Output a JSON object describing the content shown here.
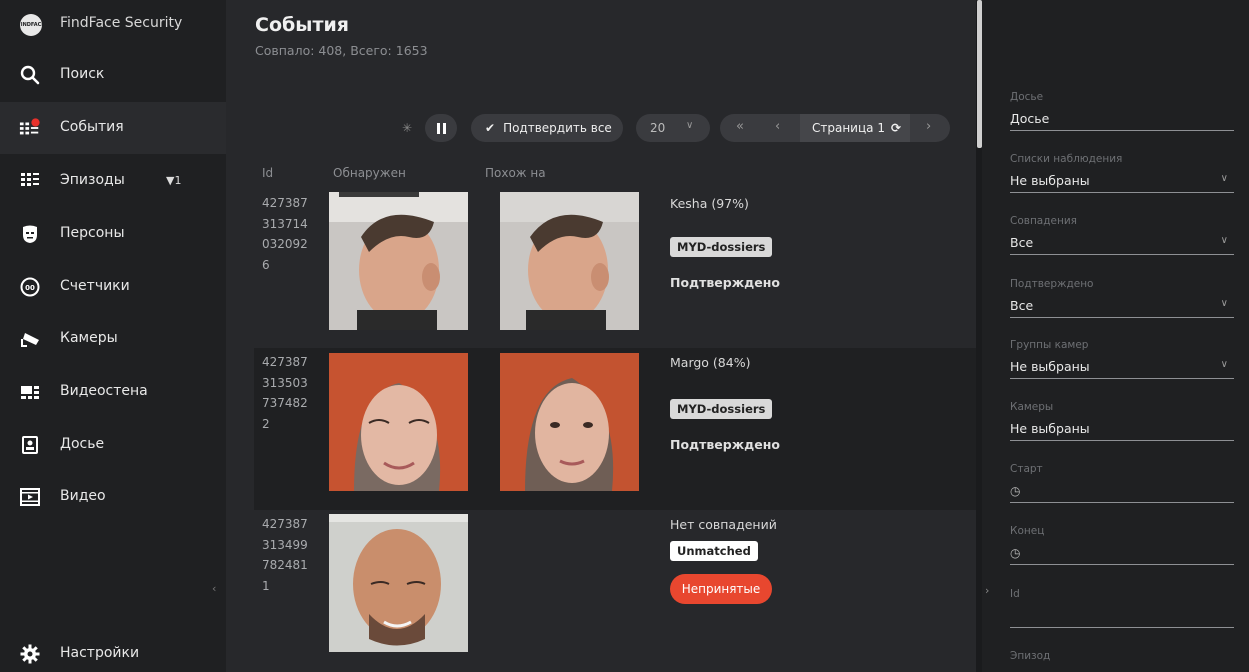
{
  "brand": {
    "name": "FindFace Security",
    "logo_text": "FINDFACE"
  },
  "sidebar": {
    "items": [
      {
        "key": "search",
        "label": "Поиск",
        "icon": "search-icon"
      },
      {
        "key": "events",
        "label": "События",
        "icon": "events-icon",
        "active": true
      },
      {
        "key": "episodes",
        "label": "Эпизоды",
        "icon": "episodes-icon",
        "filter_count": "1"
      },
      {
        "key": "persons",
        "label": "Персоны",
        "icon": "persons-icon"
      },
      {
        "key": "counters",
        "label": "Счетчики",
        "icon": "counters-icon"
      },
      {
        "key": "cameras",
        "label": "Камеры",
        "icon": "camera-icon"
      },
      {
        "key": "videowall",
        "label": "Видеостена",
        "icon": "videowall-icon"
      },
      {
        "key": "dossier",
        "label": "Досье",
        "icon": "dossier-icon"
      },
      {
        "key": "video",
        "label": "Видео",
        "icon": "video-icon"
      }
    ],
    "settings": {
      "label": "Настройки",
      "icon": "gear-icon"
    },
    "collapse_glyph": "‹"
  },
  "main": {
    "title": "События",
    "subtitle": "Совпало: 408, Всего: 1653",
    "toolbar": {
      "confirm_all": "Подтвердить все",
      "page_size": "20",
      "page_label": "Страница 1",
      "first_glyph": "«",
      "prev_glyph": "‹",
      "next_glyph": "›"
    },
    "columns": {
      "id": "Id",
      "detected": "Обнаружен",
      "matched": "Похож на"
    },
    "events": [
      {
        "id_lines": [
          "427387",
          "313714",
          "032092",
          "6"
        ],
        "match": "Kesha (97%)",
        "tag": "MYD-dossiers",
        "status": "Подтверждено"
      },
      {
        "id_lines": [
          "427387",
          "313503",
          "737482",
          "2"
        ],
        "match": "Margo (84%)",
        "tag": "MYD-dossiers",
        "status": "Подтверждено"
      },
      {
        "id_lines": [
          "427387",
          "313499",
          "782481",
          "1"
        ],
        "match": "Нет совпадений",
        "tag": "Unmatched",
        "action": "Непринятые"
      }
    ]
  },
  "filters": {
    "toggle_glyph": "›",
    "groups": [
      {
        "label": "Досье",
        "value": "Досье"
      },
      {
        "label": "Списки наблюдения",
        "value": "Не выбраны",
        "dropdown": true
      },
      {
        "label": "Совпадения",
        "value": "Все",
        "dropdown": true
      },
      {
        "label": "Подтверждено",
        "value": "Все",
        "dropdown": true
      },
      {
        "label": "Группы камер",
        "value": "Не выбраны",
        "dropdown": true
      },
      {
        "label": "Камеры",
        "value": "Не выбраны"
      },
      {
        "label": "Старт",
        "value": ""
      },
      {
        "label": "Конец",
        "value": ""
      },
      {
        "label": "Id",
        "value": ""
      },
      {
        "label": "Эпизод",
        "value": ""
      }
    ]
  },
  "colors": {
    "accent_red": "#e8472f",
    "badge_red": "#e8312b"
  }
}
